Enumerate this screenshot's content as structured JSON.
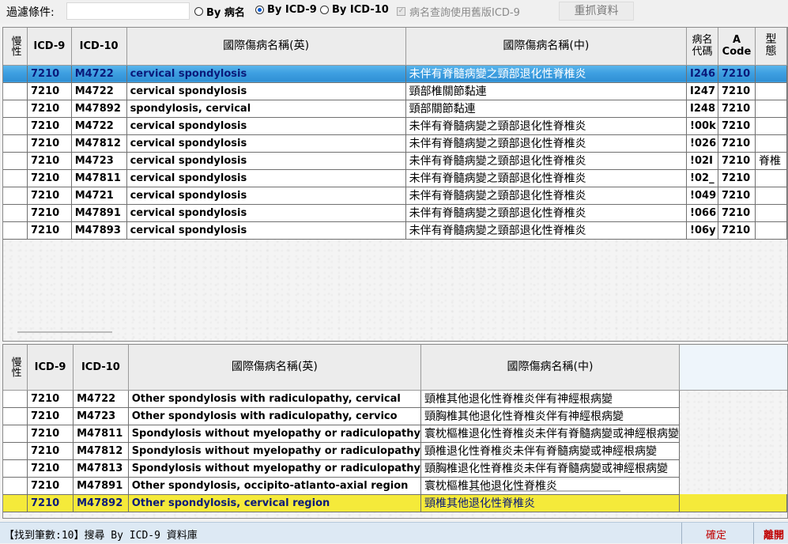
{
  "toolbar": {
    "filter_label": "過濾條件:",
    "filter_value": "",
    "radio_by_name": "By 病名",
    "radio_by_icd9": "By ICD-9",
    "radio_by_icd10": "By ICD-10",
    "checkbox_old_icd9": "病名查詢使用舊版ICD-9",
    "reload_button": "重抓資料",
    "selected_radio": "By ICD-9"
  },
  "top_grid": {
    "headers": {
      "chronic": "慢性",
      "icd9": "ICD-9",
      "icd10": "ICD-10",
      "name_en": "國際傷病名稱(英)",
      "name_zh": "國際傷病名稱(中)",
      "disease_code": "病名代碼",
      "a_code": "A Code",
      "pattern": "型態"
    },
    "rows": [
      {
        "icd9": "7210",
        "icd10": "M4722",
        "en": "cervical spondylosis",
        "zh": "未伴有脊髓病變之頸部退化性脊椎炎",
        "code": "I246",
        "acode": "7210",
        "type": ""
      },
      {
        "icd9": "7210",
        "icd10": "M4722",
        "en": "cervical spondylosis",
        "zh": "頸部椎關節黏連",
        "code": "I247",
        "acode": "7210",
        "type": ""
      },
      {
        "icd9": "7210",
        "icd10": "M47892",
        "en": "spondylosis, cervical",
        "zh": "頸部關節黏連",
        "code": "I248",
        "acode": "7210",
        "type": ""
      },
      {
        "icd9": "7210",
        "icd10": "M4722",
        "en": "cervical spondylosis",
        "zh": "未伴有脊髓病變之頸部退化性脊椎炎",
        "code": "!00k",
        "acode": "7210",
        "type": ""
      },
      {
        "icd9": "7210",
        "icd10": "M47812",
        "en": "cervical spondylosis",
        "zh": "未伴有脊髓病變之頸部退化性脊椎炎",
        "code": "!026",
        "acode": "7210",
        "type": ""
      },
      {
        "icd9": "7210",
        "icd10": "M4723",
        "en": "cervical spondylosis",
        "zh": "未伴有脊髓病變之頸部退化性脊椎炎",
        "code": "!02I",
        "acode": "7210",
        "type": "脊椎"
      },
      {
        "icd9": "7210",
        "icd10": "M47811",
        "en": "cervical spondylosis",
        "zh": "未伴有脊髓病變之頸部退化性脊椎炎",
        "code": "!02_",
        "acode": "7210",
        "type": ""
      },
      {
        "icd9": "7210",
        "icd10": "M4721",
        "en": "cervical spondylosis",
        "zh": "未伴有脊髓病變之頸部退化性脊椎炎",
        "code": "!049",
        "acode": "7210",
        "type": ""
      },
      {
        "icd9": "7210",
        "icd10": "M47891",
        "en": "cervical spondylosis",
        "zh": "未伴有脊髓病變之頸部退化性脊椎炎",
        "code": "!066",
        "acode": "7210",
        "type": ""
      },
      {
        "icd9": "7210",
        "icd10": "M47893",
        "en": "cervical spondylosis",
        "zh": "未伴有脊髓病變之頸部退化性脊椎炎",
        "code": "!06y",
        "acode": "7210",
        "type": ""
      }
    ]
  },
  "bottom_grid": {
    "headers": {
      "chronic": "慢性",
      "icd9": "ICD-9",
      "icd10": "ICD-10",
      "name_en": "國際傷病名稱(英)",
      "name_zh": "國際傷病名稱(中)"
    },
    "rows": [
      {
        "icd9": "7210",
        "icd10": "M4722",
        "en": "Other spondylosis with radiculopathy, cervical",
        "zh": "頸椎其他退化性脊椎炎伴有神經根病變"
      },
      {
        "icd9": "7210",
        "icd10": "M4723",
        "en": "Other spondylosis with radiculopathy, cervico",
        "zh": "頸胸椎其他退化性脊椎炎伴有神經根病變"
      },
      {
        "icd9": "7210",
        "icd10": "M47811",
        "en": "Spondylosis without myelopathy or radiculopathy",
        "zh": "寰枕樞椎退化性脊椎炎未伴有脊髓病變或神經根病變"
      },
      {
        "icd9": "7210",
        "icd10": "M47812",
        "en": "Spondylosis without myelopathy or radiculopathy",
        "zh": "頸椎退化性脊椎炎未伴有脊髓病變或神經根病變"
      },
      {
        "icd9": "7210",
        "icd10": "M47813",
        "en": "Spondylosis without myelopathy or radiculopathy",
        "zh": "頸胸椎退化性脊椎炎未伴有脊髓病變或神經根病變"
      },
      {
        "icd9": "7210",
        "icd10": "M47891",
        "en": "Other spondylosis, occipito-atlanto-axial region",
        "zh": "寰枕樞椎其他退化性脊椎炎"
      },
      {
        "icd9": "7210",
        "icd10": "M47892",
        "en": "Other spondylosis, cervical region",
        "zh": "頸椎其他退化性脊椎炎"
      }
    ]
  },
  "status": {
    "message": "【找到筆數:10】搜尋 By ICD-9 資料庫",
    "confirm": "確定",
    "quit": "離開"
  },
  "colors": {
    "selection_blue": "#3d9ee0",
    "selection_yellow": "#f5ea3a",
    "status_red": "#c00000"
  }
}
